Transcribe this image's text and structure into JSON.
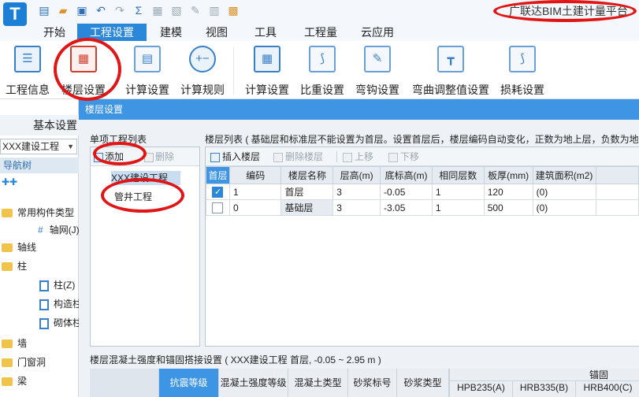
{
  "app": {
    "logo_letter": "T",
    "title": "广联达BIM土建计量平台",
    "accent": "#2b87d8",
    "annotation_color": "#e01616"
  },
  "quick_access": {
    "icons": [
      "file-new-icon",
      "open-folder-icon",
      "save-icon",
      "undo-icon",
      "redo-icon",
      "sum-icon",
      "grey-tool-icon",
      "grey-tool-icon-2",
      "grey-tool-icon-3",
      "grey-tool-icon-4",
      "export-icon"
    ]
  },
  "tabs": [
    {
      "label": "开始"
    },
    {
      "label": "工程设置"
    },
    {
      "label": "建模"
    },
    {
      "label": "视图"
    },
    {
      "label": "工具"
    },
    {
      "label": "工程量"
    },
    {
      "label": "云应用"
    }
  ],
  "ribbon": {
    "buttons": [
      {
        "label": "工程信息"
      },
      {
        "label": "楼层设置"
      },
      {
        "label": "计算设置"
      },
      {
        "label": "计算规则"
      },
      {
        "label": "计算设置"
      },
      {
        "label": "比重设置"
      },
      {
        "label": "弯钩设置"
      },
      {
        "label": "弯曲调整值设置"
      },
      {
        "label": "损耗设置"
      }
    ]
  },
  "left_panel": {
    "header": "基本设置",
    "combo_value": "XXX建设工程",
    "nav_label": "导航树",
    "tree": [
      {
        "label": "常用构件类型"
      },
      {
        "label": "轴网(J)"
      },
      {
        "label": "轴线"
      },
      {
        "label": "柱"
      },
      {
        "label": "柱(Z)"
      },
      {
        "label": "构造柱"
      },
      {
        "label": "砌体柱"
      },
      {
        "label": "墙"
      },
      {
        "label": "门窗洞"
      },
      {
        "label": "梁"
      }
    ]
  },
  "dialog": {
    "title": "楼层设置",
    "project_list": {
      "label": "单项工程列表",
      "add_label": "添加",
      "delete_label": "删除",
      "items": [
        {
          "label": "XXX建设工程"
        },
        {
          "label": "管井工程"
        }
      ]
    },
    "floor_list": {
      "label": "楼层列表 ( 基础层和标准层不能设置为首层。设置首层后，楼层编码自动变化，正数为地上层，负数为地下层 )",
      "insert_label": "插入楼层",
      "delete_label": "删除楼层",
      "up_label": "上移",
      "down_label": "下移",
      "columns": [
        "首层",
        "编码",
        "楼层名称",
        "层高(m)",
        "底标高(m)",
        "相同层数",
        "板厚(mm)",
        "建筑面积(m2)"
      ],
      "rows": [
        {
          "first": true,
          "code": "1",
          "name": "首层",
          "height": "3",
          "bottom": "-0.05",
          "same": "1",
          "slab": "120",
          "area": "(0)"
        },
        {
          "first": false,
          "code": "0",
          "name": "基础层",
          "height": "3",
          "bottom": "-3.05",
          "same": "1",
          "slab": "500",
          "area": "(0)"
        }
      ]
    },
    "concrete_label": "楼层混凝土强度和锚固搭接设置 ( XXX建设工程 首层, -0.05 ~ 2.95 m )",
    "concrete_columns": [
      "抗震等级",
      "混凝土强度等级",
      "混凝土类型",
      "砂浆标号",
      "砂浆类型"
    ],
    "anchor_label": "锚固",
    "anchor_columns": [
      "HPB235(A)",
      "HRB335(B)",
      "HRB400(C)"
    ],
    "ellipsis": "..."
  }
}
